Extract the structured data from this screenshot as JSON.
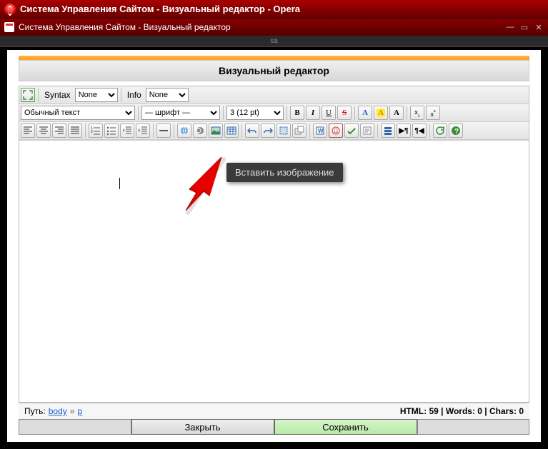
{
  "browser": {
    "title": "Система Управления Сайтом - Визуальный редактор - Opera",
    "tab_title": "Система Управления Сайтом - Визуальный редактор",
    "sub_label": "sa"
  },
  "editor": {
    "heading": "Визуальный редактор",
    "syntax_label": "Syntax",
    "syntax_value": "None",
    "info_label": "Info",
    "info_value": "None",
    "format_value": "Обычный текст",
    "font_value": "— шрифт —",
    "size_value": "3 (12 pt)",
    "tooltip": "Вставить изображение"
  },
  "icons": {
    "bold": "B",
    "italic": "I",
    "underline": "U",
    "strike": "S",
    "font_color": "A",
    "bg_color": "A",
    "clear_format": "A",
    "sub": "x",
    "sub2": "₂",
    "sup": "x",
    "sup2": "²"
  },
  "status": {
    "path_label": "Путь:",
    "path_body": "body",
    "path_sep": "»",
    "path_p": "p",
    "right": "HTML: 59 | Words: 0 | Chars: 0"
  },
  "buttons": {
    "close": "Закрыть",
    "save": "Сохранить"
  }
}
